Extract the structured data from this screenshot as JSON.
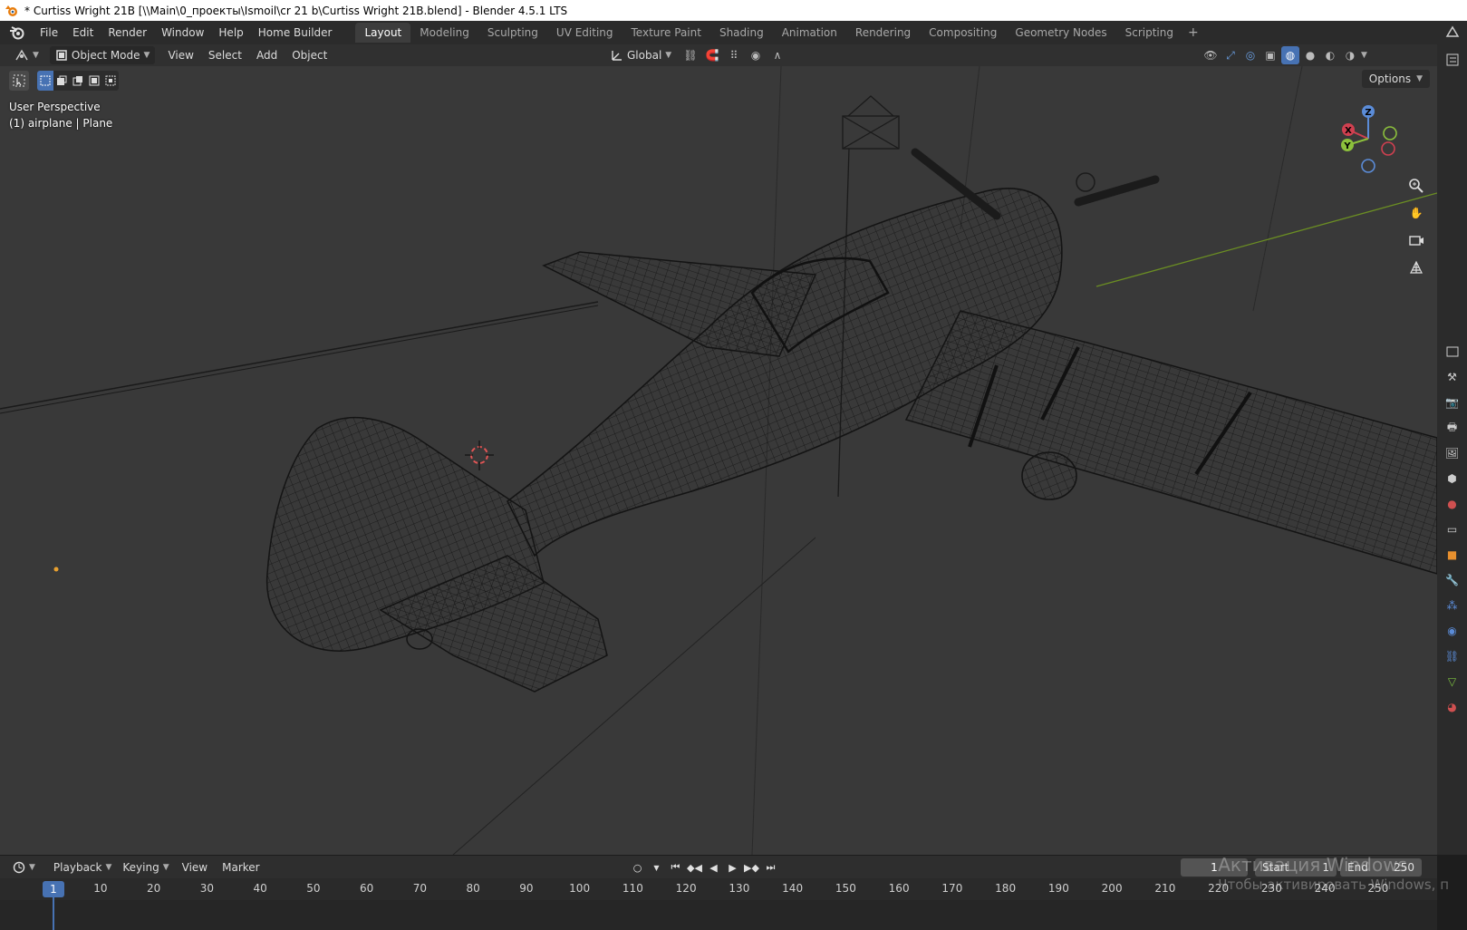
{
  "window": {
    "title": "* Curtiss Wright 21B [\\\\Main\\0_проекты\\Ismoil\\cr 21 b\\Curtiss Wright 21B.blend] - Blender 4.5.1 LTS"
  },
  "menu": {
    "items": [
      "File",
      "Edit",
      "Render",
      "Window",
      "Help",
      "Home Builder"
    ]
  },
  "workspaces": {
    "tabs": [
      "Layout",
      "Modeling",
      "Sculpting",
      "UV Editing",
      "Texture Paint",
      "Shading",
      "Animation",
      "Rendering",
      "Compositing",
      "Geometry Nodes",
      "Scripting"
    ],
    "active": "Layout",
    "add_label": "+"
  },
  "viewport_header": {
    "mode": "Object Mode",
    "menus": [
      "View",
      "Select",
      "Add",
      "Object"
    ],
    "orientation": "Global",
    "options_label": "Options"
  },
  "viewport": {
    "perspective": "User Perspective",
    "object_info": "(1) airplane | Plane"
  },
  "gizmo": {
    "x": "X",
    "y": "Y",
    "z": "Z"
  },
  "timeline": {
    "menus": [
      "Playback",
      "Keying",
      "View",
      "Marker"
    ],
    "current_frame": "1",
    "start_label": "Start",
    "start_value": "1",
    "end_label": "End",
    "end_value": "250",
    "ticks": [
      "10",
      "20",
      "30",
      "40",
      "50",
      "60",
      "70",
      "80",
      "90",
      "100",
      "110",
      "120",
      "130",
      "140",
      "150",
      "160",
      "170",
      "180",
      "190",
      "200",
      "210",
      "220",
      "230",
      "240",
      "250"
    ]
  },
  "watermark": {
    "line1": "Активация Windows",
    "line2": "Чтобы активировать Windows, п"
  },
  "colors": {
    "viewport_bg": "#393939",
    "header_bg": "#303030",
    "active_blue": "#4772b3",
    "wire": "#141414",
    "axis_y_green": "#6b8e23"
  }
}
